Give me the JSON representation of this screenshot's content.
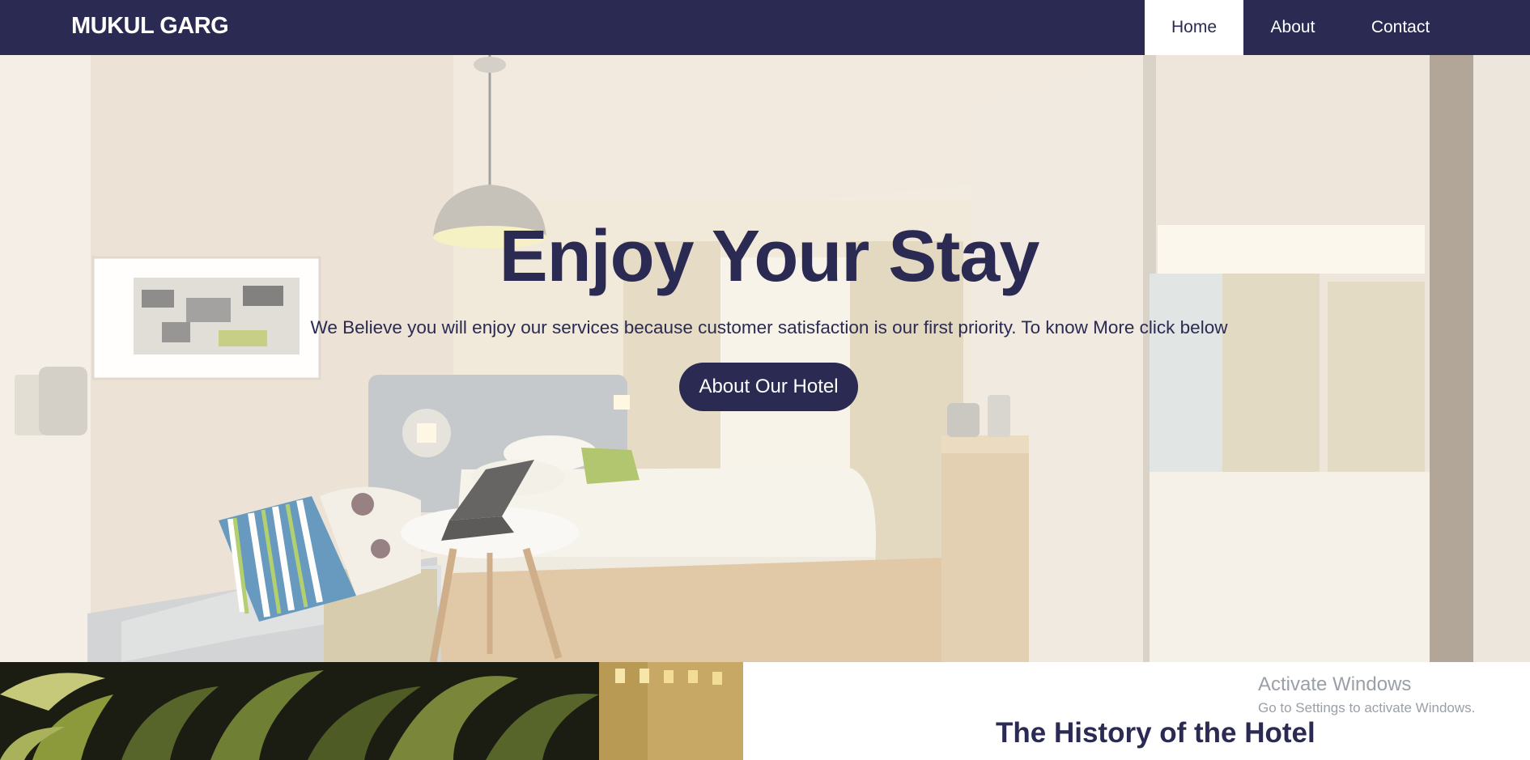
{
  "navbar": {
    "brand": "MUKUL GARG",
    "links": [
      {
        "label": "Home",
        "active": true
      },
      {
        "label": "About",
        "active": false
      },
      {
        "label": "Contact",
        "active": false
      }
    ],
    "background_color": "#2a2a52"
  },
  "hero": {
    "title": "Enjoy Your Stay",
    "subtitle": "We Believe you will enjoy our services because customer satisfaction is our first priority. To know More click below",
    "button_label": "About Our Hotel",
    "accent_color": "#2a2a52"
  },
  "history": {
    "title": "The History of the Hotel"
  },
  "watermark": {
    "title": "Activate Windows",
    "subtitle": "Go to Settings to activate Windows."
  }
}
